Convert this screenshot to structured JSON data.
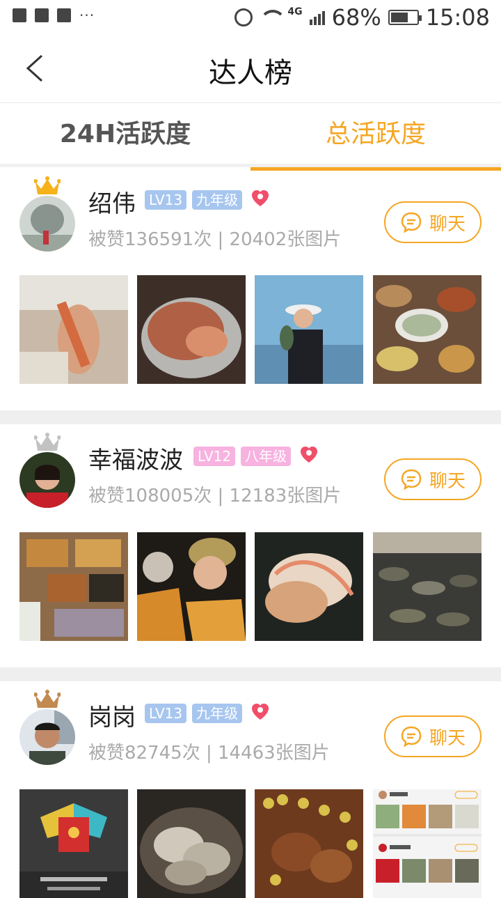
{
  "status": {
    "percent": "68%",
    "time": "15:08",
    "net": "4G"
  },
  "nav": {
    "title": "达人榜"
  },
  "tabs": [
    "24H活跃度",
    "总活跃度"
  ],
  "chat_label": "聊天",
  "users": [
    {
      "name": "绍伟",
      "level": "LV13",
      "grade": "九年级",
      "stats": "被赞136591次 | 20402张图片"
    },
    {
      "name": "幸福波波",
      "level": "LV12",
      "grade": "八年级",
      "stats": "被赞108005次 | 12183张图片"
    },
    {
      "name": "岗岗",
      "level": "LV13",
      "grade": "九年级",
      "stats": "被赞82745次 | 14463张图片"
    }
  ],
  "colors": {
    "accent": "#f5a623",
    "badge_blue": "#a7c6ef",
    "badge_pink": "#f7b2e0",
    "heart": "#f04e6b"
  }
}
